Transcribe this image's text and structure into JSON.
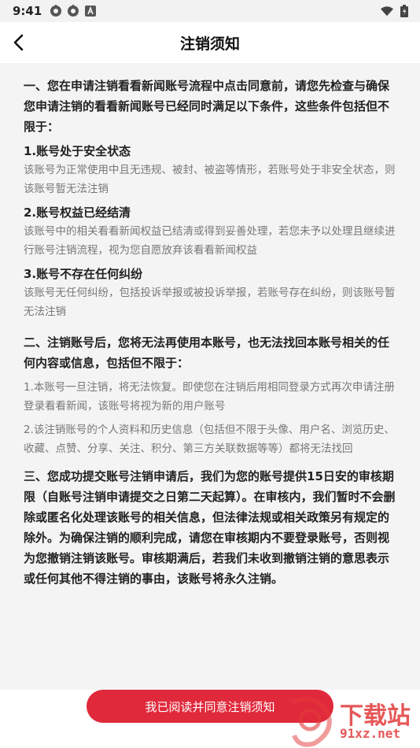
{
  "status_bar": {
    "time": "9:41",
    "left_icons": [
      "settings-gear-icon",
      "settings-gear-icon",
      "a-icon"
    ],
    "right_icons": [
      "wifi-icon",
      "battery-icon"
    ]
  },
  "nav": {
    "title": "注销须知"
  },
  "content": {
    "intro": "一、您在申请注销看看新闻账号流程中点击同意前，请您先检查与确保您申请注销的看看新闻账号已经同时满足以下条件，这些条件包括但不限于：",
    "conditions": [
      {
        "title": "1.账号处于安全状态",
        "desc": "该账号为正常使用中且无违规、被封、被盗等情形，若账号处于非安全状态，则该账号暂无法注销"
      },
      {
        "title": "2.账号权益已经结清",
        "desc": "该账号中的相关看看新闻权益已结清或得到妥善处理，若您未予以处理且继续进行账号注销流程，视为您自愿放弃该看看新闻权益"
      },
      {
        "title": "3.账号不存在任何纠纷",
        "desc": "该账号无任何纠纷，包括投诉举报或被投诉举报，若账号存在纠纷，则该账号暂无法注销"
      }
    ],
    "section2_title": "二、注销账号后，您将无法再使用本账号，也无法找回本账号相关的任何内容或信息，包括但不限于：",
    "section2_items": [
      "1.本账号一旦注销，将无法恢复。即使您在注销后用相同登录方式再次申请注册登录看看新闻，该账号将视为新的用户账号",
      "2.该注销账号的个人资料和历史信息（包括但不限于头像、用户名、浏览历史、收藏、点赞、分享、关注、积分、第三方关联数据等等）都将无法找回"
    ],
    "section3": "三、您成功提交账号注销申请后，我们为您的账号提供15日安的审核期限（自账号注销申请提交之日第二天起算）。在审核内，我们暂时不会删除或匿名化处理该账号的相关信息，但法律法规或相关政策另有规定的除外。为确保注销的顺利完成，请您在审核期内不要登录账号，否则视为您撤销注销该账号。审核期满后，若我们未收到撤销注销的意思表示或任何其他不得注销的事由，该账号将永久注销。"
  },
  "bottom": {
    "agree_label": "我已阅读并同意注销须知"
  },
  "watermark": {
    "text": "下载站",
    "url": "91xz.net"
  },
  "colors": {
    "accent": "#e0293b",
    "background": "#f4f4f4",
    "body_text": "#222222",
    "secondary_text": "#777777"
  }
}
